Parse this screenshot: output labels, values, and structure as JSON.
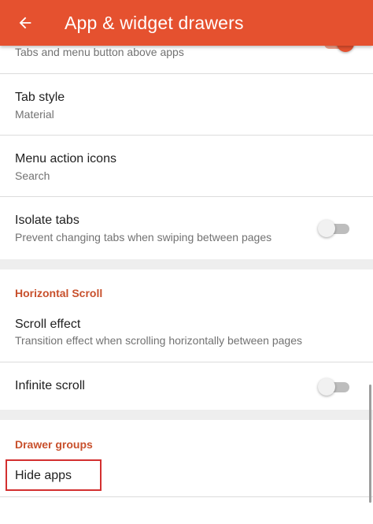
{
  "appbar": {
    "title": "App & widget drawers",
    "back_icon": "arrow-back-icon",
    "background": "#e5512f"
  },
  "top_partial": {
    "summary": "Tabs and menu button above apps",
    "toggle_on": true
  },
  "tab_style": {
    "title": "Tab style",
    "summary": "Material"
  },
  "menu_action_icons": {
    "title": "Menu action icons",
    "summary": "Search"
  },
  "isolate_tabs": {
    "title": "Isolate tabs",
    "summary": "Prevent changing tabs when swiping between pages",
    "toggle_on": false
  },
  "horizontal_scroll": {
    "header": "Horizontal Scroll",
    "scroll_effect": {
      "title": "Scroll effect",
      "summary": "Transition effect when scrolling horizontally between pages"
    },
    "infinite_scroll": {
      "title": "Infinite scroll",
      "toggle_on": false
    }
  },
  "drawer_groups": {
    "header": "Drawer groups",
    "hide_apps": {
      "title": "Hide apps"
    }
  },
  "colors": {
    "accent": "#e5512f",
    "section_header": "#c8502c",
    "highlight_box": "#d32f2f"
  }
}
